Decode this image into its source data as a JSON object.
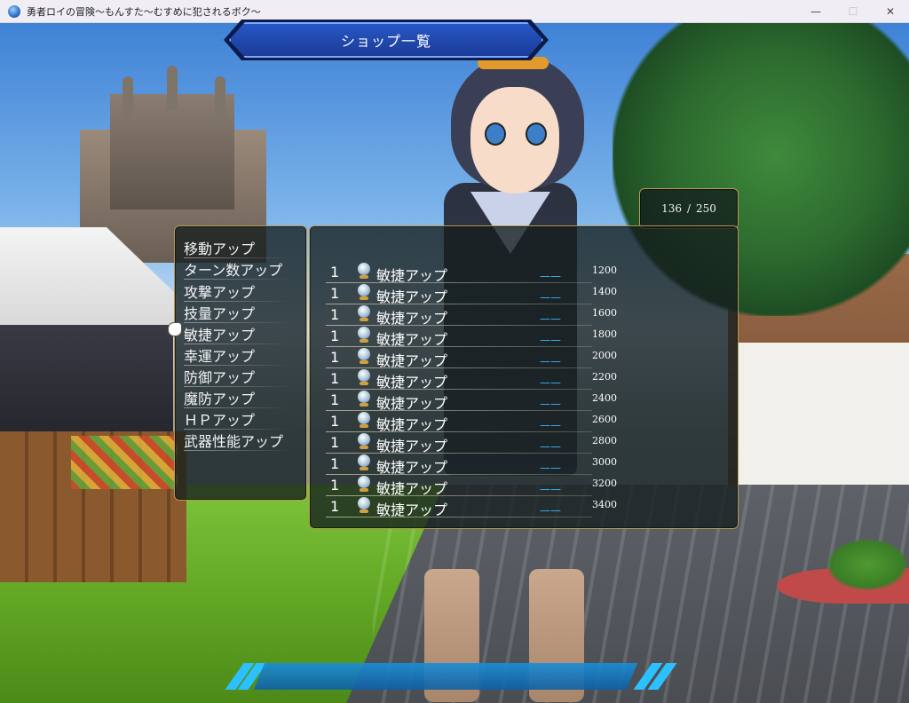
{
  "window": {
    "title": "勇者ロイの冒険〜もんすた〜むすめに犯されるボク〜",
    "minimize": "—",
    "maximize": "☐",
    "close": "✕"
  },
  "shop": {
    "title": "ショップ一覧",
    "gold_current": "136",
    "gold_separator": "/",
    "gold_max": "250"
  },
  "categories": [
    "移動アップ",
    "ターン数アップ",
    "攻撃アップ",
    "技量アップ",
    "敏捷アップ",
    "幸運アップ",
    "防御アップ",
    "魔防アップ",
    "ＨＰアップ",
    "武器性能アップ"
  ],
  "selected_category": "敏捷アップ",
  "items": [
    {
      "qty": "1",
      "name": "敏捷アップ",
      "status": "——",
      "price": "1200"
    },
    {
      "qty": "1",
      "name": "敏捷アップ",
      "status": "——",
      "price": "1400"
    },
    {
      "qty": "1",
      "name": "敏捷アップ",
      "status": "——",
      "price": "1600"
    },
    {
      "qty": "1",
      "name": "敏捷アップ",
      "status": "——",
      "price": "1800"
    },
    {
      "qty": "1",
      "name": "敏捷アップ",
      "status": "——",
      "price": "2000"
    },
    {
      "qty": "1",
      "name": "敏捷アップ",
      "status": "——",
      "price": "2200"
    },
    {
      "qty": "1",
      "name": "敏捷アップ",
      "status": "——",
      "price": "2400"
    },
    {
      "qty": "1",
      "name": "敏捷アップ",
      "status": "——",
      "price": "2600"
    },
    {
      "qty": "1",
      "name": "敏捷アップ",
      "status": "——",
      "price": "2800"
    },
    {
      "qty": "1",
      "name": "敏捷アップ",
      "status": "——",
      "price": "3000"
    },
    {
      "qty": "1",
      "name": "敏捷アップ",
      "status": "——",
      "price": "3200"
    },
    {
      "qty": "1",
      "name": "敏捷アップ",
      "status": "——",
      "price": "3400"
    }
  ],
  "colors": {
    "status_dash": "#39b6ff",
    "window_border": "#b89a52",
    "banner": "#2858c8"
  },
  "icons": {
    "item_icon": "crystal-orb-icon",
    "cursor": "hand-pointer-icon"
  }
}
